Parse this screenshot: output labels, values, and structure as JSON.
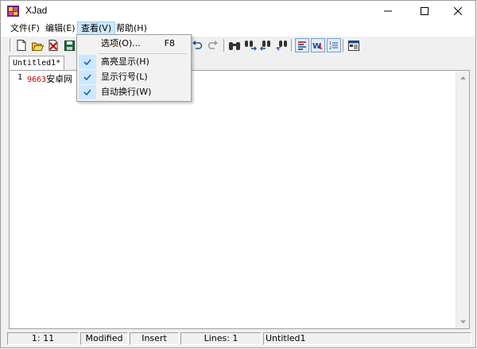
{
  "window": {
    "title": "XJad"
  },
  "menubar": {
    "items": [
      {
        "label": "文件(F)"
      },
      {
        "label": "编辑(E)"
      },
      {
        "label": "查看(V)"
      },
      {
        "label": "帮助(H)"
      }
    ]
  },
  "view_menu": {
    "options": {
      "label": "选项(O)...",
      "shortcut": "F8"
    },
    "highlight": {
      "label": "高亮显示(H)",
      "checked": true
    },
    "line_numbers": {
      "label": "显示行号(L)",
      "checked": true
    },
    "word_wrap": {
      "label": "自动换行(W)",
      "checked": true
    }
  },
  "tabs": [
    {
      "label": "Untitled1*"
    }
  ],
  "editor": {
    "line_number": "1",
    "number_token": "9663",
    "text_token": "安卓网"
  },
  "statusbar": {
    "position": "1: 11",
    "modified": "Modified",
    "mode": "Insert",
    "lines": "Lines: 1",
    "filename": "Untitled1"
  },
  "colors": {
    "menu_highlight": "#cce8ff",
    "number_token": "#d00000",
    "check_mark": "#1a62b4"
  }
}
